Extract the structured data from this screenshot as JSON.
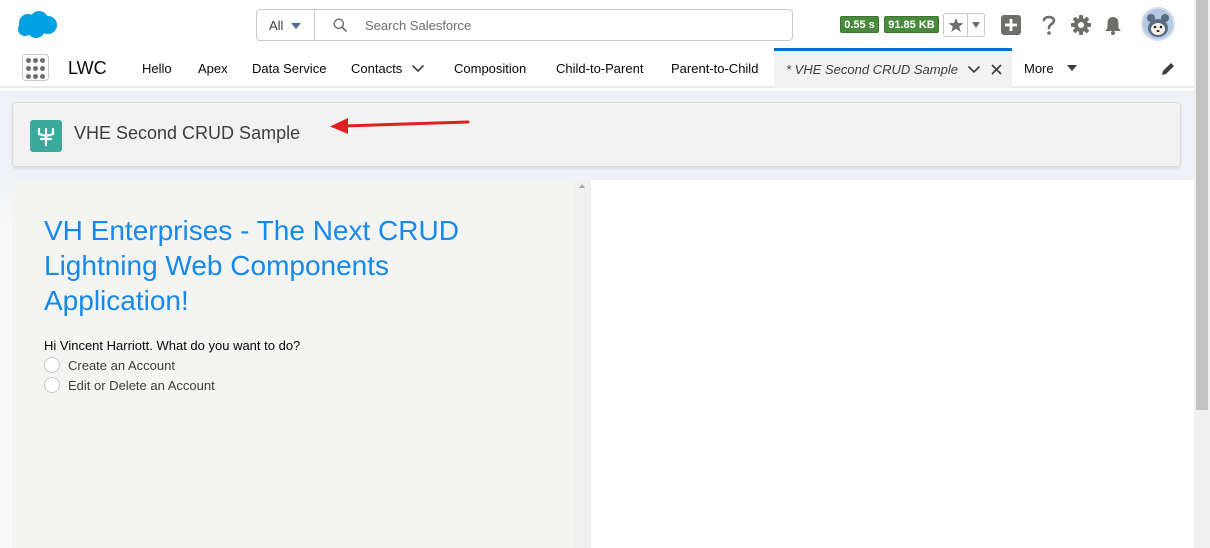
{
  "header": {
    "search": {
      "scope": "All",
      "placeholder": "Search Salesforce"
    },
    "badges": {
      "time": "0.55 s",
      "size": "91.85 KB"
    }
  },
  "nav": {
    "app_name": "LWC",
    "items": [
      {
        "label": "Hello"
      },
      {
        "label": "Apex"
      },
      {
        "label": "Data Service"
      },
      {
        "label": "Contacts"
      },
      {
        "label": "Composition"
      },
      {
        "label": "Child-to-Parent"
      },
      {
        "label": "Parent-to-Child"
      }
    ],
    "active_tab": "* VHE Second CRUD Sample",
    "more": "More"
  },
  "page": {
    "title": "VHE Second CRUD Sample",
    "hero": "VH Enterprises - The Next CRUD Lightning Web Components Application!",
    "question": "Hi Vincent Harriott. What do you want to do?",
    "options": [
      {
        "label": "Create an Account"
      },
      {
        "label": "Edit or Delete an Account"
      }
    ]
  },
  "colors": {
    "brand_blue": "#1589ee",
    "badge_green": "#4a8a3c",
    "page_icon": "#3ba99c",
    "annotation_arrow": "#e02020"
  },
  "icons": [
    "salesforce-cloud-icon",
    "search-icon",
    "star-icon",
    "plus-icon",
    "help-icon",
    "gear-icon",
    "bell-icon",
    "astro-avatar-icon",
    "app-launcher-icon",
    "chevron-down-icon",
    "close-icon",
    "pencil-icon",
    "tree-icon",
    "red-arrow-icon"
  ]
}
